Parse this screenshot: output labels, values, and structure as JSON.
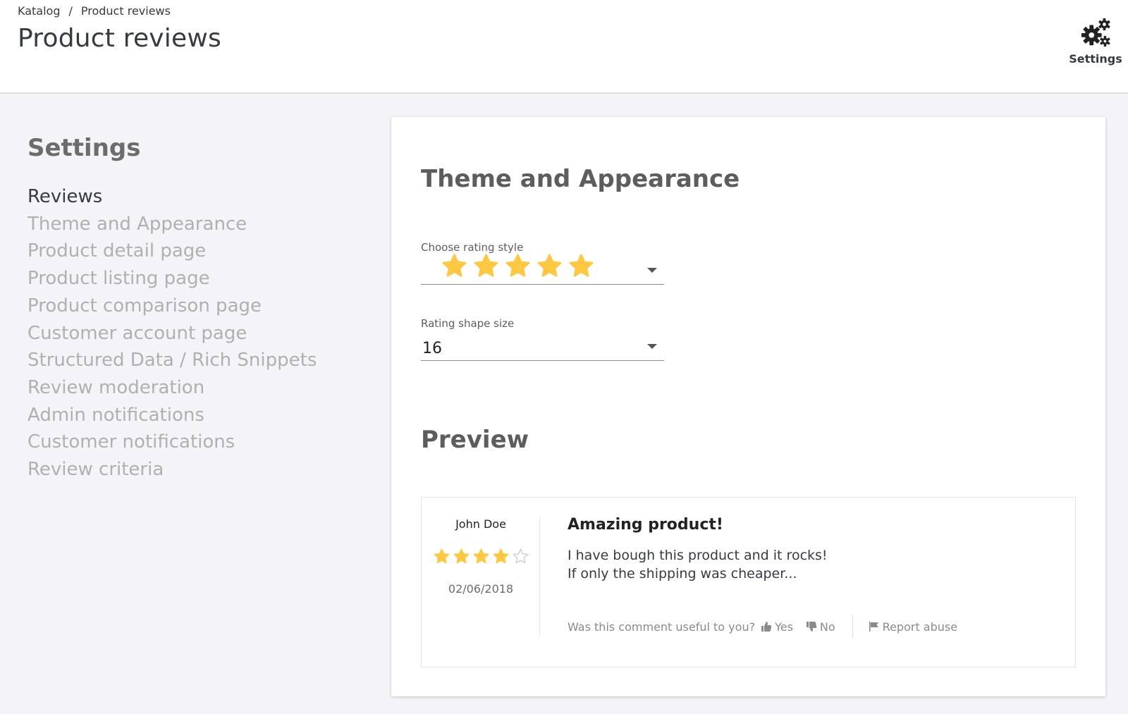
{
  "header": {
    "breadcrumb": [
      "Katalog",
      "Product reviews"
    ],
    "breadcrumb_separator": "/",
    "title": "Product reviews",
    "settings_label": "Settings",
    "settings_icon": "gears-icon"
  },
  "sidebar": {
    "title": "Settings",
    "items": [
      {
        "label": "Reviews",
        "active": true
      },
      {
        "label": "Theme and Appearance",
        "active": false
      },
      {
        "label": "Product detail page",
        "active": false
      },
      {
        "label": "Product listing page",
        "active": false
      },
      {
        "label": "Product comparison page",
        "active": false
      },
      {
        "label": "Customer account page",
        "active": false
      },
      {
        "label": "Structured Data / Rich Snippets",
        "active": false
      },
      {
        "label": "Review moderation",
        "active": false
      },
      {
        "label": "Admin notifications",
        "active": false
      },
      {
        "label": "Customer notifications",
        "active": false
      },
      {
        "label": "Review criteria",
        "active": false
      }
    ]
  },
  "main": {
    "section_title": "Theme and Appearance",
    "rating_style": {
      "label": "Choose rating style",
      "selected_icon": "star-icon",
      "selected_star_count": 5
    },
    "shape_size": {
      "label": "Rating shape size",
      "value": "16"
    },
    "preview_title": "Preview",
    "preview": {
      "author": "John Doe",
      "rating": 4,
      "rating_max": 5,
      "date": "02/06/2018",
      "title": "Amazing product!",
      "text_line1": "I have bough this product and it rocks!",
      "text_line2": "If only the shipping was cheaper...",
      "useful_question": "Was this comment useful to you?",
      "yes_label": "Yes",
      "no_label": "No",
      "report_label": "Report abuse"
    }
  },
  "colors": {
    "star": "#ffc843",
    "star_empty_stroke": "#c8c8c8",
    "page_bg": "#f4f4f8",
    "text_primary": "#363a41",
    "text_muted": "#b0b0b3"
  }
}
